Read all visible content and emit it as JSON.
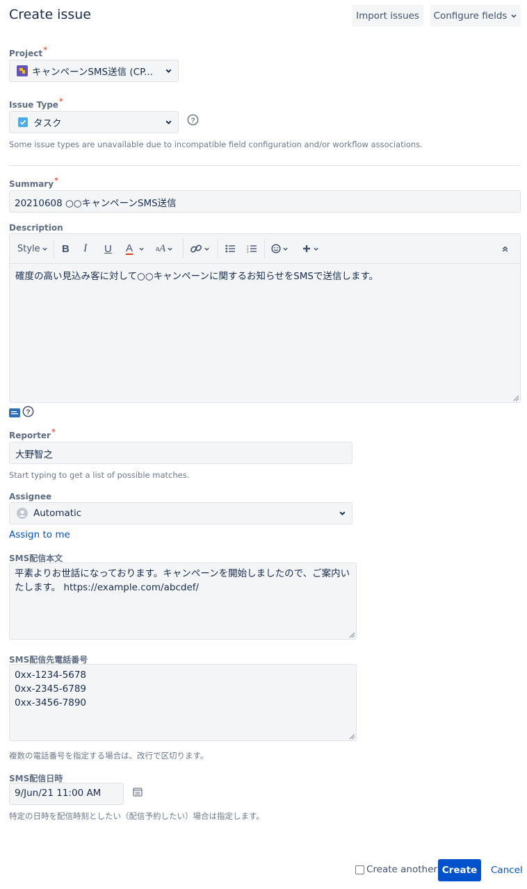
{
  "header": {
    "title": "Create issue",
    "import_label": "Import issues",
    "configure_label": "Configure fields"
  },
  "project": {
    "label": "Project",
    "value": "キャンペーンSMS送信 (CP..."
  },
  "issue_type": {
    "label": "Issue Type",
    "value": "タスク",
    "help": "Some issue types are unavailable due to incompatible field configuration and/or workflow associations."
  },
  "summary": {
    "label": "Summary",
    "value": "20210608 ○○キャンペーンSMS送信"
  },
  "description": {
    "label": "Description",
    "toolbar": {
      "style_label": "Style"
    },
    "value": "確度の高い見込み客に対して○○キャンペーンに関するお知らせをSMSで送信します。"
  },
  "reporter": {
    "label": "Reporter",
    "value": "大野智之",
    "help": "Start typing to get a list of possible matches."
  },
  "assignee": {
    "label": "Assignee",
    "value": "Automatic",
    "assign_to_me": "Assign to me"
  },
  "sms_body": {
    "label": "SMS配信本文",
    "value": "平素よりお世話になっております。キャンペーンを開始しましたので、ご案内いたします。 https://example.com/abcdef/"
  },
  "sms_phone": {
    "label": "SMS配信先電話番号",
    "value": "0xx-1234-5678\n0xx-2345-6789\n0xx-3456-7890",
    "help": "複数の電話番号を指定する場合は、改行で区切ります。"
  },
  "sms_datetime": {
    "label": "SMS配信日時",
    "value": "9/Jun/21 11:00 AM",
    "help": "特定の日時を配信時刻としたい（配信予約したい）場合は指定します。"
  },
  "footer": {
    "create_another_label": "Create another",
    "create_label": "Create",
    "cancel_label": "Cancel"
  },
  "colors": {
    "primary": "#0052cc",
    "required": "#de350b",
    "link": "#0052cc"
  }
}
